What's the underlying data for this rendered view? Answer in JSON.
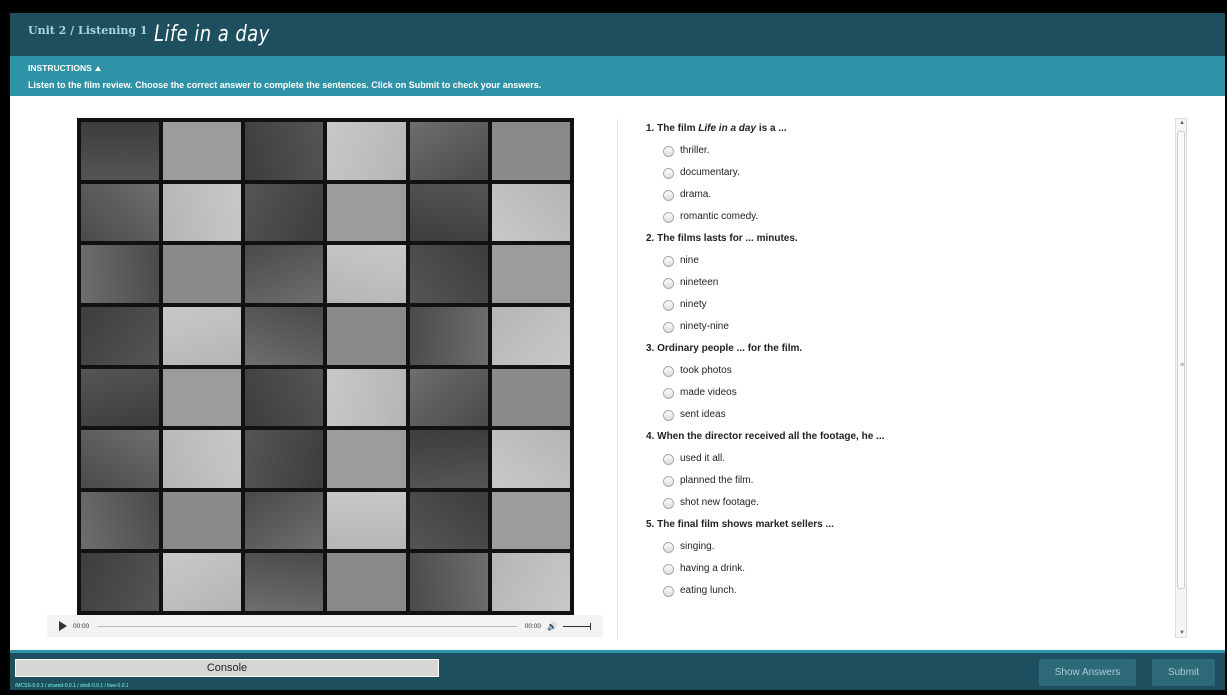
{
  "header": {
    "unit": "Unit 2 / Listening 1",
    "title": "Life in a day"
  },
  "instructions": {
    "heading": "INSTRUCTIONS",
    "text": "Listen to the film review. Choose the correct answer to complete the sentences. Click on Submit to check your answers."
  },
  "player": {
    "time_current": "00:00",
    "time_total": "00:00"
  },
  "questions": [
    {
      "number": "1.",
      "before": "The film ",
      "italic": "Life in a day",
      "after": " is a ...",
      "options": [
        "thriller.",
        "documentary.",
        "drama.",
        "romantic comedy."
      ]
    },
    {
      "number": "2.",
      "before": "The films lasts for ... minutes.",
      "italic": "",
      "after": "",
      "options": [
        "nine",
        "nineteen",
        "ninety",
        "ninety-nine"
      ]
    },
    {
      "number": "3.",
      "before": "Ordinary people ... for the film.",
      "italic": "",
      "after": "",
      "options": [
        "took photos",
        "made videos",
        "sent ideas"
      ]
    },
    {
      "number": "4.",
      "before": "When the director received all the footage, he ...",
      "italic": "",
      "after": "",
      "options": [
        "used it all.",
        "planned the film.",
        "shot new footage."
      ]
    },
    {
      "number": "5.",
      "before": "The final film shows market sellers ...",
      "italic": "",
      "after": "",
      "options": [
        "singing.",
        "having a drink.",
        "eating lunch."
      ]
    }
  ],
  "footer": {
    "console": "Console",
    "version": "/MCSS-0.0.1 / shared-0.0.1 / shell-0.0.1 / ltsw-0.0.1",
    "show_answers": "Show Answers",
    "submit": "Submit"
  },
  "colors": {
    "header": "#1d4f5e",
    "accent": "#2e93a7",
    "button": "#2e6978"
  }
}
